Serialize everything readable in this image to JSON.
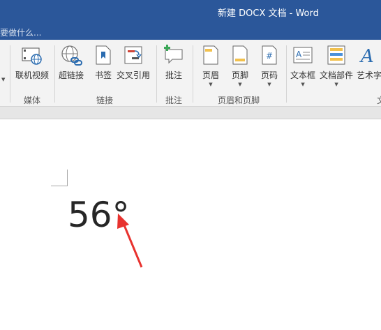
{
  "window": {
    "title": "新建 DOCX 文档 - Word",
    "tell_me": "要做什么..."
  },
  "ribbon": {
    "buttons": {
      "online_video": "联机视频",
      "hyperlink": "超链接",
      "bookmark": "书签",
      "cross_reference": "交叉引用",
      "comment": "批注",
      "header": "页眉",
      "footer": "页脚",
      "page_number": "页码",
      "text_box": "文本框",
      "quick_parts": "文档部件",
      "wordart": "艺术字"
    },
    "groups": {
      "media": "媒体",
      "links": "链接",
      "comments": "批注",
      "header_footer": "页眉和页脚",
      "text": "文"
    }
  },
  "document": {
    "text": "56°"
  },
  "colors": {
    "title_bar": "#2b579a",
    "ribbon_bg": "#f3f3f3",
    "annotation_arrow": "#e8322e"
  }
}
